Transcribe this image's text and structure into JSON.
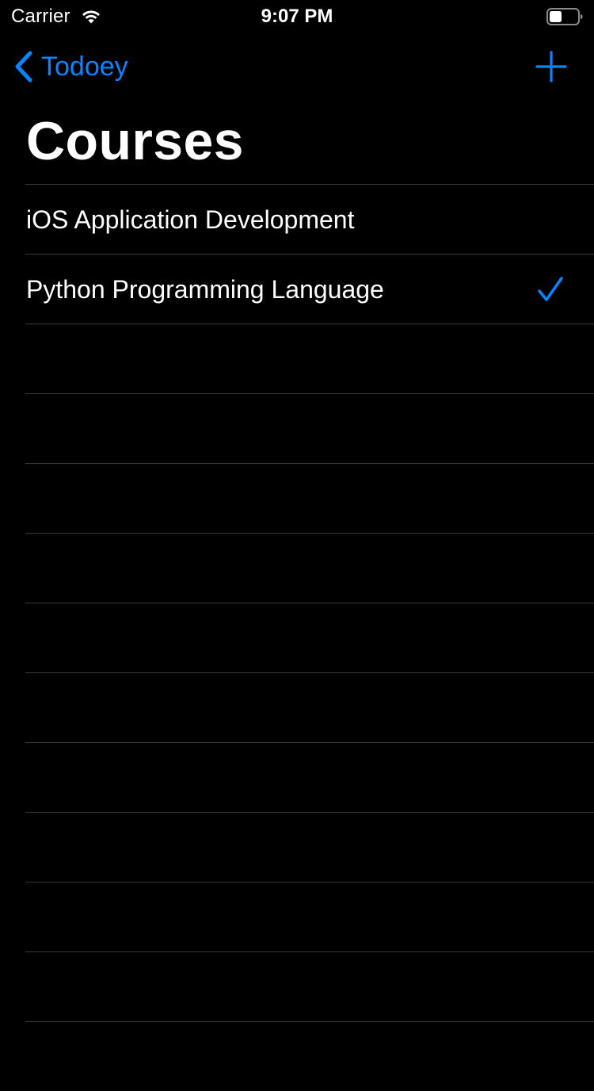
{
  "status_bar": {
    "carrier": "Carrier",
    "time": "9:07 PM",
    "icons": [
      "wifi-icon",
      "battery-icon"
    ]
  },
  "nav": {
    "back_label": "Todoey",
    "back_icon": "chevron-left-icon",
    "add_icon": "plus-icon"
  },
  "title": "Courses",
  "items": [
    {
      "label": "iOS Application Development",
      "checked": false
    },
    {
      "label": "Python Programming Language",
      "checked": true
    }
  ],
  "theme": {
    "background": "#000000",
    "accent": "#0a84ff",
    "separator": "#38383a",
    "text": "#ffffff"
  }
}
